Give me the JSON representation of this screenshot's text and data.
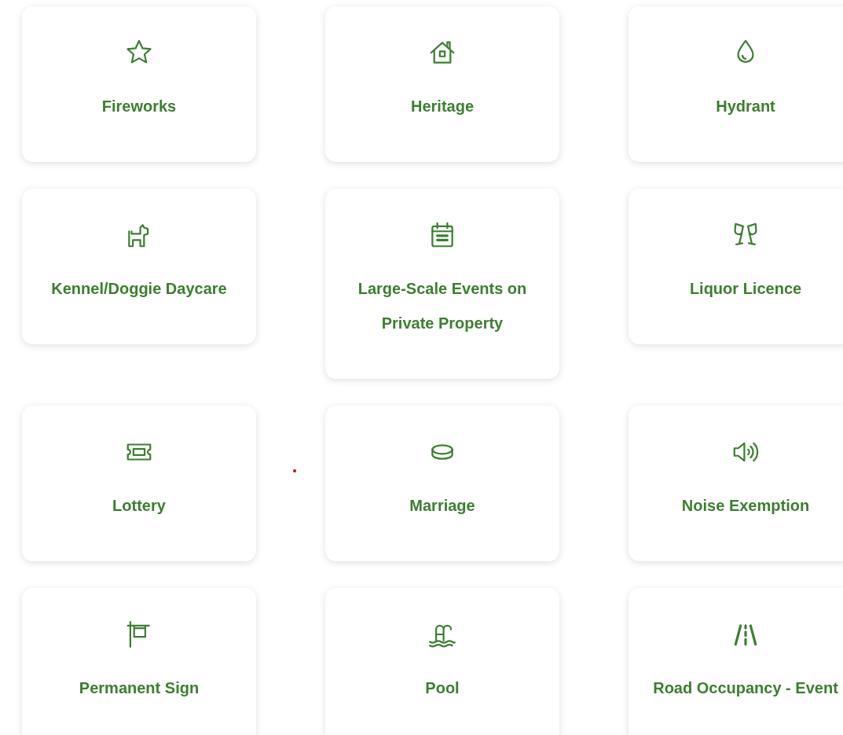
{
  "cards": [
    {
      "label": "Fireworks"
    },
    {
      "label": "Heritage"
    },
    {
      "label": "Hydrant"
    },
    {
      "label": "Kennel/Doggie Daycare"
    },
    {
      "label": "Large-Scale Events on Private Property"
    },
    {
      "label": "Liquor Licence"
    },
    {
      "label": "Lottery"
    },
    {
      "label": "Marriage"
    },
    {
      "label": "Noise Exemption"
    },
    {
      "label": "Permanent Sign"
    },
    {
      "label": "Pool"
    },
    {
      "label": "Road Occupancy - Event"
    }
  ]
}
